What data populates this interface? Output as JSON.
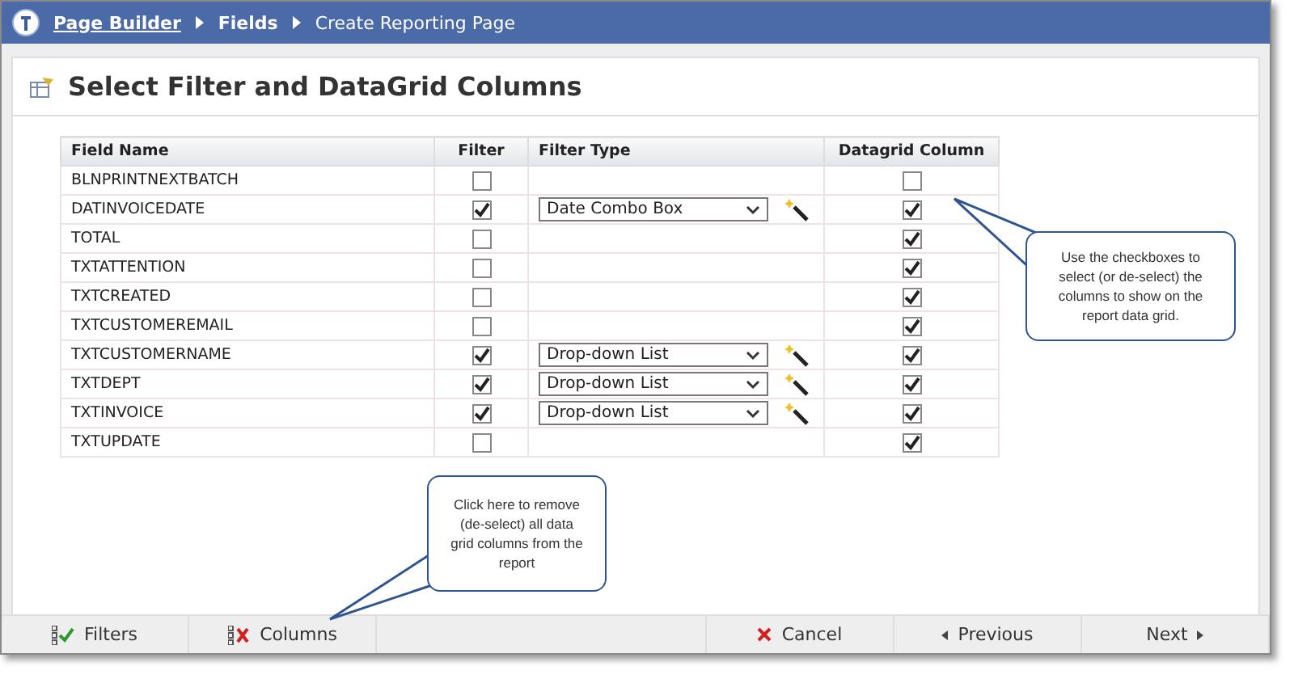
{
  "breadcrumb": [
    {
      "label": "Page Builder",
      "kind": "link"
    },
    {
      "label": "Fields",
      "kind": "bold"
    },
    {
      "label": "Create Reporting Page",
      "kind": "plain"
    }
  ],
  "title": "Select Filter and DataGrid Columns",
  "table": {
    "columns": [
      "Field Name",
      "Filter",
      "Filter Type",
      "Datagrid Column"
    ],
    "rows": [
      {
        "name": "BLNPRINTNEXTBATCH",
        "filter": false,
        "datagrid": false
      },
      {
        "name": "DATINVOICEDATE",
        "filter": true,
        "filter_type": "Date Combo Box",
        "datagrid": true
      },
      {
        "name": "TOTAL",
        "filter": false,
        "datagrid": true
      },
      {
        "name": "TXTATTENTION",
        "filter": false,
        "datagrid": true
      },
      {
        "name": "TXTCREATED",
        "filter": false,
        "datagrid": true
      },
      {
        "name": "TXTCUSTOMEREMAIL",
        "filter": false,
        "datagrid": true
      },
      {
        "name": "TXTCUSTOMERNAME",
        "filter": true,
        "filter_type": "Drop-down List",
        "datagrid": true
      },
      {
        "name": "TXTDEPT",
        "filter": true,
        "filter_type": "Drop-down List",
        "datagrid": true
      },
      {
        "name": "TXTINVOICE",
        "filter": true,
        "filter_type": "Drop-down List",
        "datagrid": true
      },
      {
        "name": "TXTUPDATE",
        "filter": false,
        "datagrid": true
      }
    ]
  },
  "callouts": [
    "Use the checkboxes to select (or de-select) the columns to show on the report data grid.",
    "Click here to remove (de-select) all data grid columns from the report"
  ],
  "footer": [
    {
      "label": "Filters",
      "kind": "filters"
    },
    {
      "label": "Columns",
      "kind": "columns"
    },
    {
      "kind": "spacer"
    },
    {
      "label": "Cancel",
      "kind": "cancel"
    },
    {
      "label": "Previous",
      "kind": "previous"
    },
    {
      "label": "Next",
      "kind": "next"
    }
  ]
}
